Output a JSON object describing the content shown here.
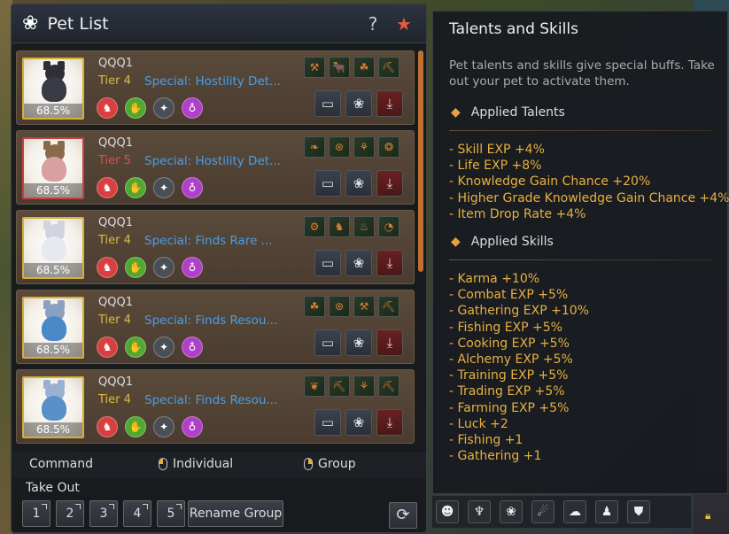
{
  "panel": {
    "title": "Pet List",
    "help": "?",
    "star": "★"
  },
  "pets": [
    {
      "name": "QQQ1",
      "tier": "Tier 4",
      "special": "Special: Hostility Det...",
      "hunger": "68.5%",
      "skills": [
        "⚒",
        "🐂",
        "☘",
        "⛏"
      ],
      "colors": {
        "body": "#3a3a44",
        "head": "#2e2e36"
      }
    },
    {
      "name": "QQQ1",
      "tier": "Tier 5",
      "special": "Special: Hostility Det...",
      "hunger": "68.5%",
      "skills": [
        "❧",
        "⊛",
        "⚘",
        "❂"
      ],
      "colors": {
        "body": "#d8a0a0",
        "head": "#8a6a4a"
      }
    },
    {
      "name": "QQQ1",
      "tier": "Tier 4",
      "special": "Special: Finds Rare ...",
      "hunger": "68.5%",
      "skills": [
        "⚙",
        "♞",
        "♨",
        "◔"
      ],
      "colors": {
        "body": "#e8e8f0",
        "head": "#d0d4de"
      }
    },
    {
      "name": "QQQ1",
      "tier": "Tier 4",
      "special": "Special: Finds Resou...",
      "hunger": "68.5%",
      "skills": [
        "☘",
        "⊛",
        "⚒",
        "⛏"
      ],
      "colors": {
        "body": "#4a88c8",
        "head": "#8aa0c0"
      }
    },
    {
      "name": "QQQ1",
      "tier": "Tier 4",
      "special": "Special: Finds Resou...",
      "hunger": "68.5%",
      "skills": [
        "❦",
        "⛏",
        "⚘",
        "⛏"
      ],
      "colors": {
        "body": "#5a90c8",
        "head": "#9ab0d0"
      }
    }
  ],
  "bottom": {
    "command": "Command",
    "individual": "Individual",
    "group": "Group",
    "take_out": "Take Out",
    "slots": [
      "1",
      "2",
      "3",
      "4",
      "5"
    ],
    "rename": "Rename Group",
    "refresh": "⟳"
  },
  "tooltip": {
    "title": "Talents and Skills",
    "desc": "Pet talents and skills give special buffs. Take out your pet to activate them.",
    "talents_header": "Applied Talents",
    "talents": [
      "- Skill EXP +4%",
      "- Life EXP +8%",
      "- Knowledge Gain Chance +20%",
      "- Higher Grade Knowledge Gain Chance +4%",
      "- Item Drop Rate +4%"
    ],
    "skills_header": "Applied Skills",
    "skills": [
      "- Karma +10%",
      "- Combat EXP +5%",
      "- Gathering EXP +10%",
      "- Fishing EXP +5%",
      "- Cooking EXP +5%",
      "- Alchemy EXP +5%",
      "- Training EXP +5%",
      "- Trading EXP +5%",
      "- Farming EXP +5%",
      "- Luck +2",
      "- Fishing +1",
      "- Gathering +1"
    ]
  },
  "bottom_icons": [
    "☻",
    "♆",
    "❀",
    "☄",
    "☁",
    "♟",
    "⛊"
  ]
}
